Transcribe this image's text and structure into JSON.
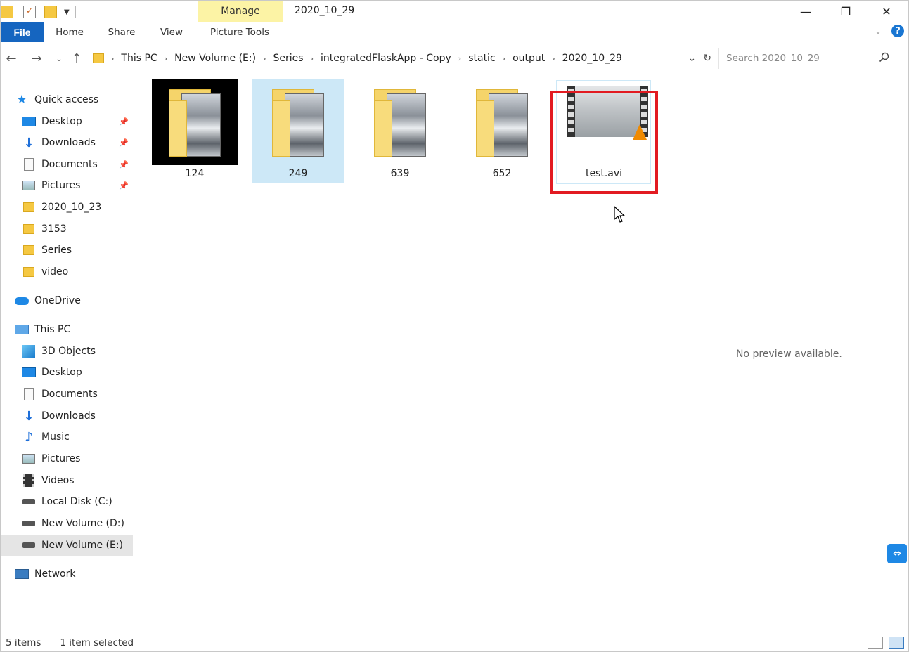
{
  "window": {
    "title": "2020_10_29",
    "manage_tab": "Manage",
    "controls": {
      "minimize": "—",
      "restore": "❐",
      "close": "✕"
    }
  },
  "ribbon": {
    "tabs": [
      "File",
      "Home",
      "Share",
      "View",
      "Picture Tools"
    ],
    "expand_icon": "chevron-down-icon",
    "help_label": "?"
  },
  "address": {
    "crumbs": [
      "This PC",
      "New Volume (E:)",
      "Series",
      "integratedFlaskApp - Copy",
      "static",
      "output",
      "2020_10_29"
    ],
    "search_placeholder": "Search 2020_10_29"
  },
  "sidebar": {
    "quick_access": {
      "label": "Quick access",
      "items": [
        {
          "label": "Desktop",
          "icon": "desktop-icon",
          "pinned": true
        },
        {
          "label": "Downloads",
          "icon": "downloads-icon",
          "pinned": true
        },
        {
          "label": "Documents",
          "icon": "documents-icon",
          "pinned": true
        },
        {
          "label": "Pictures",
          "icon": "pictures-icon",
          "pinned": true
        },
        {
          "label": "2020_10_23",
          "icon": "folder-icon",
          "pinned": false
        },
        {
          "label": "3153",
          "icon": "folder-icon",
          "pinned": false
        },
        {
          "label": "Series",
          "icon": "folder-icon",
          "pinned": false
        },
        {
          "label": "video",
          "icon": "folder-icon",
          "pinned": false
        }
      ]
    },
    "onedrive": "OneDrive",
    "this_pc": {
      "label": "This PC",
      "items": [
        "3D Objects",
        "Desktop",
        "Documents",
        "Downloads",
        "Music",
        "Pictures",
        "Videos",
        "Local Disk (C:)",
        "New Volume (D:)",
        "New Volume (E:)"
      ]
    },
    "network": "Network",
    "selected": "New Volume (E:)"
  },
  "files": [
    {
      "name": "124",
      "type": "folder"
    },
    {
      "name": "249",
      "type": "folder"
    },
    {
      "name": "639",
      "type": "folder"
    },
    {
      "name": "652",
      "type": "folder"
    },
    {
      "name": "test.avi",
      "type": "video"
    }
  ],
  "preview": {
    "message": "No preview available."
  },
  "status": {
    "count": "5 items",
    "selection": "1 item selected"
  },
  "colors": {
    "accent": "#1565c0",
    "manage": "#fcf3a5",
    "highlight_box": "#e21b22",
    "hover": "#cde8f7"
  }
}
